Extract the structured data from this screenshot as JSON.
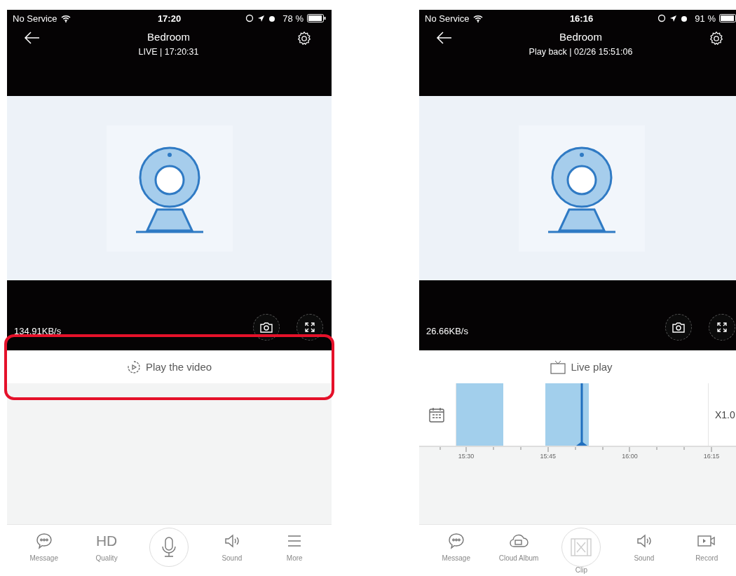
{
  "phones": [
    {
      "status": {
        "carrier": "No Service",
        "time": "17:20",
        "battery": "78 %"
      },
      "title": "Bedroom",
      "subtitle": "LIVE | 17:20:31",
      "speed": "134.91KB/s",
      "action": {
        "kind": "play",
        "label": "Play the video",
        "highlighted": true
      },
      "toolbar": [
        {
          "kind": "message",
          "label": "Message"
        },
        {
          "kind": "quality",
          "icon_text": "HD",
          "label": "Quality"
        },
        {
          "kind": "mic"
        },
        {
          "kind": "sound",
          "label": "Sound"
        },
        {
          "kind": "more",
          "label": "More"
        }
      ]
    },
    {
      "status": {
        "carrier": "No Service",
        "time": "16:16",
        "battery": "91 %"
      },
      "title": "Bedroom",
      "subtitle": "Play back | 02/26 15:51:06",
      "speed": "26.66KB/s",
      "action": {
        "kind": "live",
        "label": "Live play",
        "highlighted": false
      },
      "timeline": {
        "speed": "X1.0",
        "ticks": [
          "15:30",
          "15:45",
          "16:00",
          "16:15"
        ]
      },
      "toolbar": [
        {
          "kind": "message",
          "label": "Message"
        },
        {
          "kind": "cloud",
          "label": "Cloud Album"
        },
        {
          "kind": "clip",
          "label": "Clip"
        },
        {
          "kind": "sound",
          "label": "Sound"
        },
        {
          "kind": "record",
          "label": "Record"
        }
      ]
    }
  ]
}
